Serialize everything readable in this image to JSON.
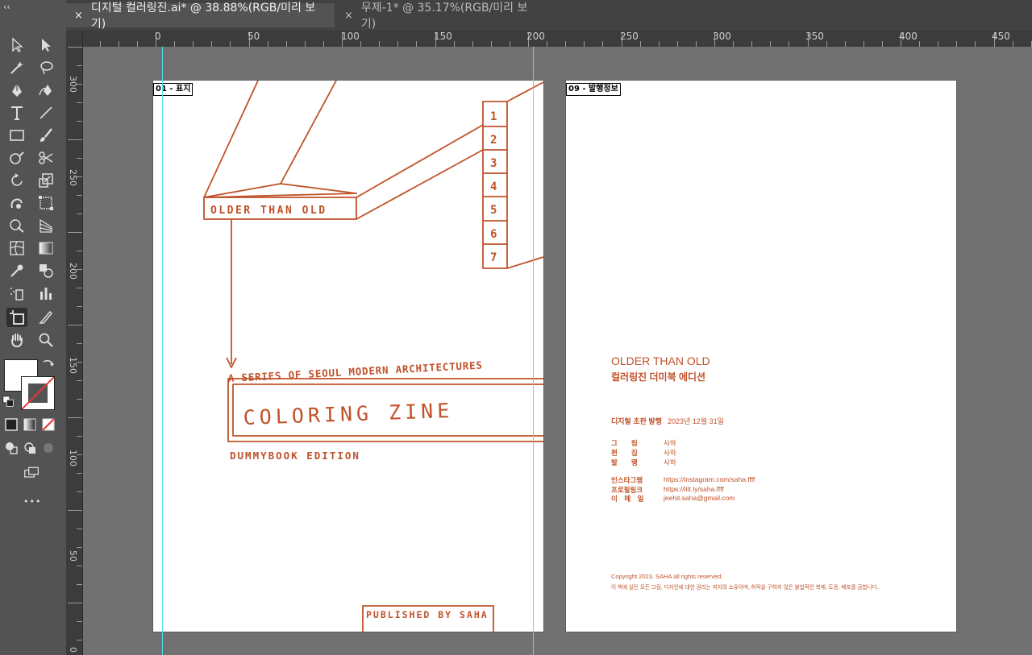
{
  "tabs": [
    {
      "close": "×",
      "title": "디지털 컬러링진.ai* @ 38.88%(RGB/미리 보기)",
      "active": true
    },
    {
      "close": "×",
      "title": "무제-1* @ 35.17%(RGB/미리 보기)",
      "active": false
    }
  ],
  "toolbar": {
    "collapse": "‹‹",
    "more": "•••",
    "tools": [
      "selection-icon",
      "direct-selection-icon",
      "magic-wand-icon",
      "lasso-icon",
      "pen-icon",
      "curvature-icon",
      "type-icon",
      "line-icon",
      "rectangle-icon",
      "paintbrush-icon",
      "shaper-icon",
      "scissors-icon",
      "rotate-icon",
      "scale-icon",
      "warp-icon",
      "free-transform-icon",
      "shape-builder-icon",
      "perspective-icon",
      "mesh-icon",
      "gradient-icon",
      "eyedropper-icon",
      "blend-icon",
      "symbol-sprayer-icon",
      "column-graph-icon",
      "artboard-icon",
      "slice-icon",
      "hand-icon",
      "zoom-icon"
    ]
  },
  "ruler": {
    "top_labels": [
      "0",
      "50",
      "100",
      "150",
      "200",
      "250",
      "300",
      "350",
      "400",
      "450"
    ],
    "left_labels": [
      "300",
      "250",
      "200",
      "150",
      "100",
      "50",
      "0"
    ]
  },
  "artboards": {
    "cover": {
      "label": "01 - 표지",
      "header": "OLDER THAN OLD",
      "numbers": [
        "1",
        "2",
        "3",
        "4",
        "5",
        "6",
        "7"
      ],
      "series": "A SERIES OF SEOUL MODERN ARCHITECTURES",
      "title": "COLORING ZINE",
      "edition": "DUMMYBOOK EDITION",
      "publisher": "PUBLISHED BY SAHA"
    },
    "colophon": {
      "label": "09 - 발행정보",
      "title_en": "OLDER THAN OLD",
      "title_ko": "컬러링진 더미북 에디션",
      "pub_label": "디지털 초판 발행",
      "pub_date": "2023년 12월 31일",
      "credits": [
        {
          "label": "그　　림",
          "value": "사하"
        },
        {
          "label": "편　　집",
          "value": "사하"
        },
        {
          "label": "발　　행",
          "value": "사하"
        }
      ],
      "contacts": [
        {
          "label": "인스타그램",
          "value": "https://instagram.com/saha.ffff"
        },
        {
          "label": "프로필링크",
          "value": "https://litt.ly/saha.ffff"
        },
        {
          "label": "이　메　일",
          "value": "jeehit.saha@gmail.com"
        }
      ],
      "copyright": "Copyright 2023. SAHA all rights reserved.",
      "notice": "이 책에 실린 모든 그림, 디자인에 대한 권리는 저자의 소유이며, 허락을 구하지 않은 불법적인 복제, 도용, 배포를 금합니다."
    }
  },
  "colors": {
    "accent": "#c0522a",
    "guide": "#4fe0ef"
  }
}
